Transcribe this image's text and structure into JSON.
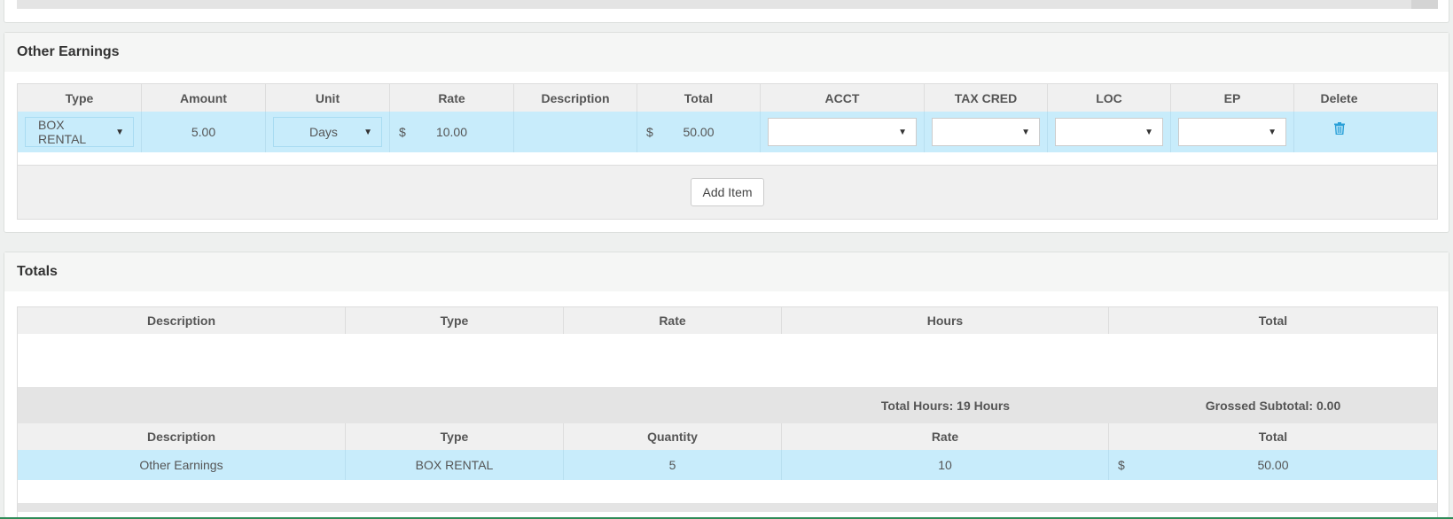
{
  "other_earnings": {
    "title": "Other Earnings",
    "columns": [
      "Type",
      "Amount",
      "Unit",
      "Rate",
      "Description",
      "Total",
      "ACCT",
      "TAX CRED",
      "LOC",
      "EP",
      "Delete"
    ],
    "row": {
      "type": "BOX RENTAL",
      "amount": "5.00",
      "unit": "Days",
      "rate_currency": "$",
      "rate": "10.00",
      "description": "",
      "total_currency": "$",
      "total": "50.00",
      "acct": "",
      "tax_cred": "",
      "loc": "",
      "ep": ""
    },
    "add_item_label": "Add Item",
    "delete_icon": "trash-icon"
  },
  "totals": {
    "title": "Totals",
    "columns": [
      "Description",
      "Type",
      "Rate",
      "Hours",
      "Total"
    ],
    "summary": {
      "total_hours": "Total Hours: 19 Hours",
      "grossed_subtotal": "Grossed Subtotal: 0.00"
    },
    "detail_columns": [
      "Description",
      "Type",
      "Quantity",
      "Rate",
      "Total"
    ],
    "detail_row": {
      "description": "Other Earnings",
      "type": "BOX RENTAL",
      "quantity": "5",
      "rate": "10",
      "total_currency": "$",
      "total": "50.00"
    }
  },
  "colors": {
    "selected_row": "#c8ecfb",
    "accent_icon": "#2aa0d8",
    "bottom_bar": "#2e8b57"
  }
}
